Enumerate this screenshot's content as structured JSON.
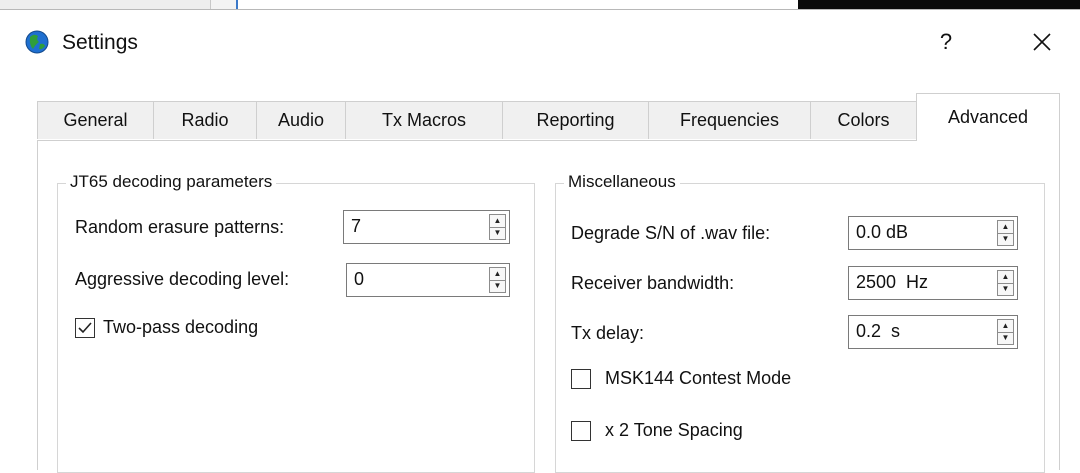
{
  "window": {
    "title": "Settings",
    "help_label": "?",
    "icon": "globe-icon",
    "help_icon": "question-icon",
    "close_icon": "close-icon"
  },
  "tabs": [
    {
      "label": "General",
      "active": false
    },
    {
      "label": "Radio",
      "active": false
    },
    {
      "label": "Audio",
      "active": false
    },
    {
      "label": "Tx Macros",
      "active": false
    },
    {
      "label": "Reporting",
      "active": false
    },
    {
      "label": "Frequencies",
      "active": false
    },
    {
      "label": "Colors",
      "active": false
    },
    {
      "label": "Advanced",
      "active": true
    }
  ],
  "jt65": {
    "title": "JT65 decoding parameters",
    "random_erasure": {
      "label": "Random erasure patterns:",
      "value": "7"
    },
    "aggressive": {
      "label": "Aggressive decoding level:",
      "value": "0"
    },
    "two_pass": {
      "label": "Two-pass decoding",
      "checked": true
    }
  },
  "misc": {
    "title": "Miscellaneous",
    "degrade": {
      "label": "Degrade S/N of .wav file:",
      "value": "0.0 dB"
    },
    "bandwidth": {
      "label": "Receiver bandwidth:",
      "value": "2500  Hz"
    },
    "tx_delay": {
      "label": "Tx delay:",
      "value": "0.2  s"
    },
    "msk144": {
      "label": "MSK144 Contest Mode",
      "checked": false
    },
    "tone_spacing": {
      "label": "x 2 Tone Spacing",
      "checked": false
    }
  },
  "colors": {
    "border": "#cfcfcf",
    "check": "#222222",
    "globe_blue": "#1e6fd0",
    "globe_green": "#2f9e3a"
  }
}
